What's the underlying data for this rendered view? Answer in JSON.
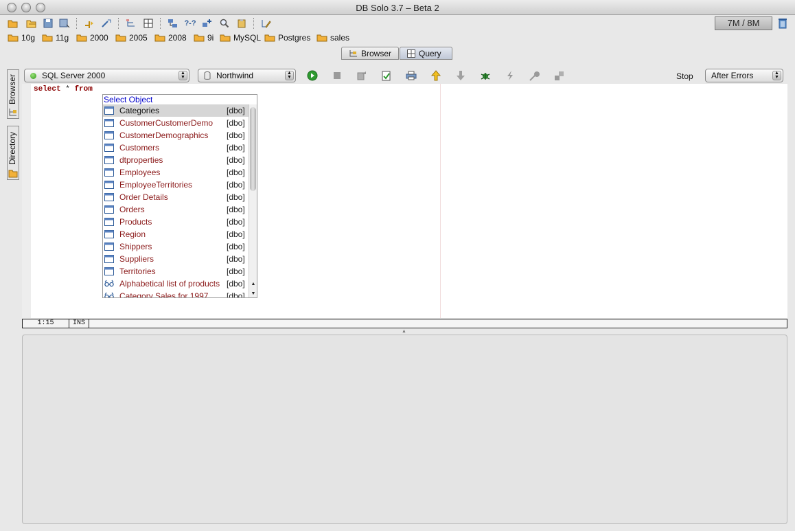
{
  "window": {
    "title": "DB Solo  3.7 – Beta 2"
  },
  "memory": {
    "label": "7M / 8M"
  },
  "favorites": [
    "10g",
    "11g",
    "2000",
    "2005",
    "2008",
    "9i",
    "MySQL",
    "Postgres",
    "sales"
  ],
  "tabs": [
    {
      "label": "Browser",
      "active": false
    },
    {
      "label": "Query",
      "active": true
    }
  ],
  "sidebar": [
    "Browser",
    "Directory"
  ],
  "query_toolbar": {
    "server": "SQL Server 2000",
    "database": "Northwind",
    "stop_label": "Stop",
    "error_mode": "After Errors"
  },
  "editor": {
    "kw_select": "select",
    "star": "*",
    "kw_from": "from"
  },
  "popup": {
    "title": "Select Object",
    "items": [
      {
        "name": "Categories",
        "schema": "[dbo]",
        "kind": "table"
      },
      {
        "name": "CustomerCustomerDemo",
        "schema": "[dbo]",
        "kind": "table"
      },
      {
        "name": "CustomerDemographics",
        "schema": "[dbo]",
        "kind": "table"
      },
      {
        "name": "Customers",
        "schema": "[dbo]",
        "kind": "table"
      },
      {
        "name": "dtproperties",
        "schema": "[dbo]",
        "kind": "table"
      },
      {
        "name": "Employees",
        "schema": "[dbo]",
        "kind": "table"
      },
      {
        "name": "EmployeeTerritories",
        "schema": "[dbo]",
        "kind": "table"
      },
      {
        "name": "Order Details",
        "schema": "[dbo]",
        "kind": "table"
      },
      {
        "name": "Orders",
        "schema": "[dbo]",
        "kind": "table"
      },
      {
        "name": "Products",
        "schema": "[dbo]",
        "kind": "table"
      },
      {
        "name": "Region",
        "schema": "[dbo]",
        "kind": "table"
      },
      {
        "name": "Shippers",
        "schema": "[dbo]",
        "kind": "table"
      },
      {
        "name": "Suppliers",
        "schema": "[dbo]",
        "kind": "table"
      },
      {
        "name": "Territories",
        "schema": "[dbo]",
        "kind": "table"
      },
      {
        "name": "Alphabetical list of products",
        "schema": "[dbo]",
        "kind": "view"
      },
      {
        "name": "Category Sales for 1997",
        "schema": "[dbo]",
        "kind": "view"
      }
    ]
  },
  "status": {
    "position": "1:15",
    "mode": "INS"
  },
  "colors": {
    "keyword": "#8b0000",
    "popup_title": "#0000cc",
    "item_text": "#8b1a1a",
    "folder": "#f2b13a"
  }
}
